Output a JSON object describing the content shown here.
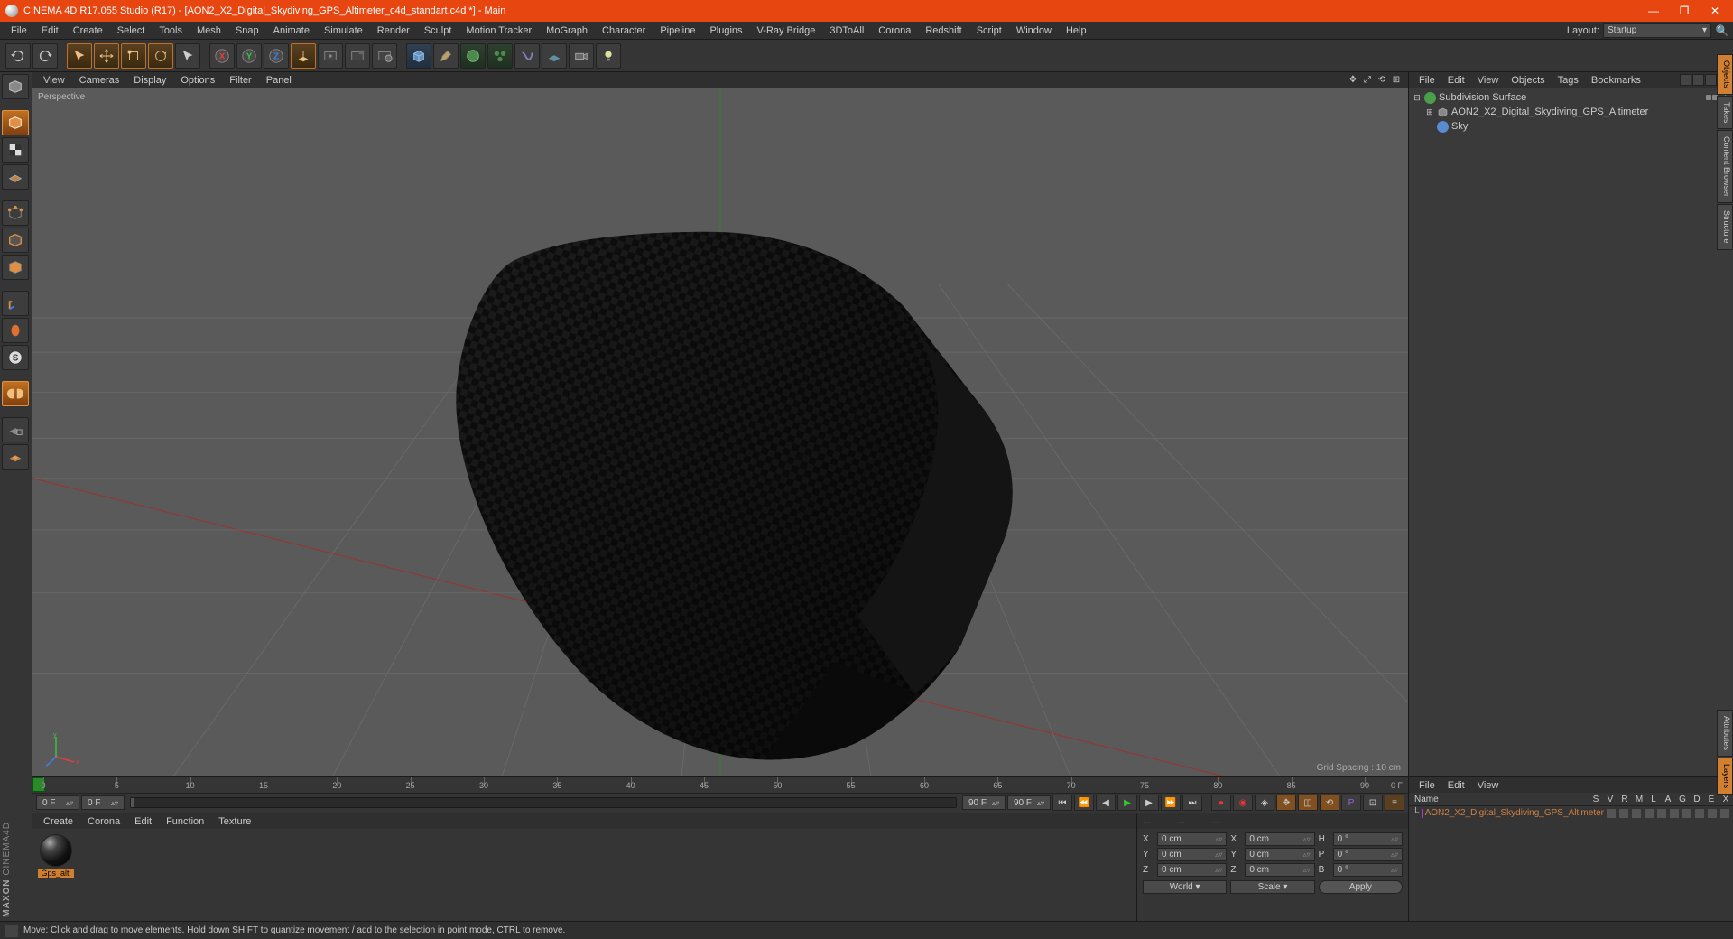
{
  "titlebar": {
    "title": "CINEMA 4D R17.055 Studio (R17) - [AON2_X2_Digital_Skydiving_GPS_Altimeter_c4d_standart.c4d *] - Main"
  },
  "menubar": {
    "items": [
      "File",
      "Edit",
      "Create",
      "Select",
      "Tools",
      "Mesh",
      "Snap",
      "Animate",
      "Simulate",
      "Render",
      "Sculpt",
      "Motion Tracker",
      "MoGraph",
      "Character",
      "Pipeline",
      "Plugins",
      "V-Ray Bridge",
      "3DToAll",
      "Corona",
      "Redshift",
      "Script",
      "Window",
      "Help"
    ],
    "layout_label": "Layout:",
    "layout_value": "Startup"
  },
  "viewmenu": {
    "items": [
      "View",
      "Cameras",
      "Display",
      "Options",
      "Filter",
      "Panel"
    ]
  },
  "viewport": {
    "label": "Perspective",
    "grid_label": "Grid Spacing : 10 cm"
  },
  "timeline": {
    "start": "0 F",
    "startpreview": "0 F",
    "end": "90 F",
    "endpreview": "90 F",
    "ticks": [
      "0",
      "5",
      "10",
      "15",
      "20",
      "25",
      "30",
      "35",
      "40",
      "45",
      "50",
      "55",
      "60",
      "65",
      "70",
      "75",
      "80",
      "85",
      "90"
    ],
    "end_label": "0 F"
  },
  "materials": {
    "menu": [
      "Create",
      "Corona",
      "Edit",
      "Function",
      "Texture"
    ],
    "item_label": "Gps_alti"
  },
  "coords": {
    "header": [
      "...",
      "...",
      "..."
    ],
    "rows": [
      {
        "l": "X",
        "v1": "0 cm",
        "l2": "X",
        "v2": "0 cm",
        "l3": "H",
        "v3": "0 °"
      },
      {
        "l": "Y",
        "v1": "0 cm",
        "l2": "Y",
        "v2": "0 cm",
        "l3": "P",
        "v3": "0 °"
      },
      {
        "l": "Z",
        "v1": "0 cm",
        "l2": "Z",
        "v2": "0 cm",
        "l3": "B",
        "v3": "0 °"
      }
    ],
    "world": "World",
    "scale": "Scale",
    "apply": "Apply"
  },
  "objectspanel": {
    "menu": [
      "File",
      "Edit",
      "View",
      "Objects",
      "Tags",
      "Bookmarks"
    ],
    "tree": [
      {
        "indent": 0,
        "exp": "⊟",
        "icon": "#4aa04a",
        "name": "Subdivision Surface",
        "tags": [
          "#888",
          "#888"
        ],
        "chk": true
      },
      {
        "indent": 1,
        "exp": "⊞",
        "icon": "#888",
        "name": "AON2_X2_Digital_Skydiving_GPS_Altimeter",
        "poly": true,
        "tags": [
          "#a040c0",
          "#888"
        ]
      },
      {
        "indent": 1,
        "exp": "",
        "icon": "#5a8ad0",
        "name": "Sky",
        "tags": [
          "#888",
          "#e33"
        ]
      }
    ]
  },
  "lowpanel": {
    "menu": [
      "File",
      "Edit",
      "View"
    ],
    "name_label": "Name",
    "cols": [
      "S",
      "V",
      "R",
      "M",
      "L",
      "A",
      "G",
      "D",
      "E",
      "X"
    ],
    "row_name": "AON2_X2_Digital_Skydiving_GPS_Altimeter"
  },
  "sidetabs": {
    "top": [
      "Objects",
      "Takes",
      "Content Browser",
      "Structure"
    ],
    "bottom": [
      "Attributes",
      "Layers"
    ]
  },
  "statusbar": {
    "text": "Move: Click and drag to move elements. Hold down SHIFT to quantize movement / add to the selection in point mode, CTRL to remove."
  },
  "logo": "MAXON CINEMA 4D"
}
